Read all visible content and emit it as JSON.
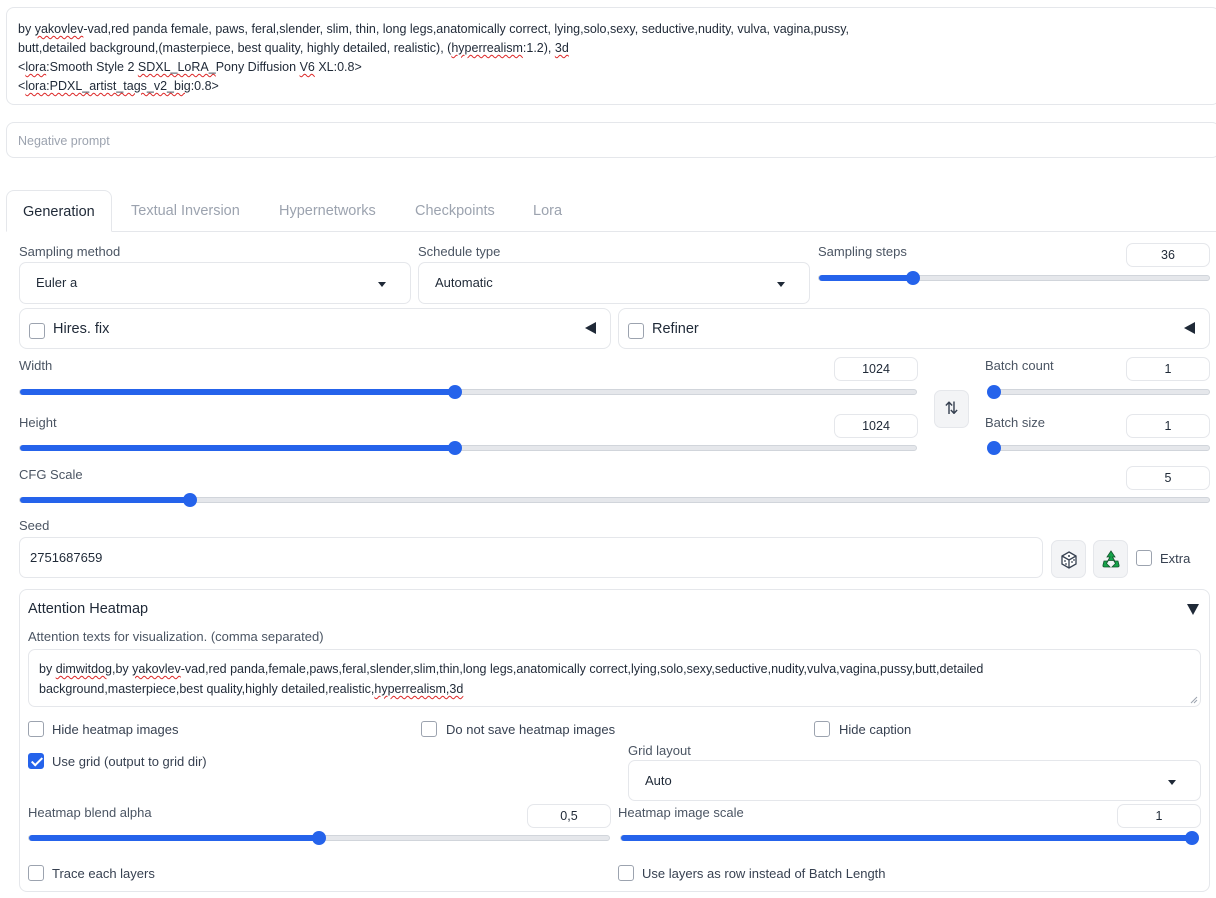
{
  "prompt": {
    "l1a": "by ",
    "l1b": "yakovlev",
    "l1c": "-vad,red panda female, paws, feral,slender, slim, thin, long legs,anatomically correct, lying,solo,sexy, seductive,nudity, vulva, vagina,pussy,",
    "l2a": "butt,detailed background,(masterpiece, best quality, highly detailed, realistic), (",
    "l2b": "hyperrealism",
    "l2c": ":1.2), ",
    "l2d": "3d",
    "l3a": "<",
    "l3b": "lora",
    "l3c": ":Smooth Style 2 ",
    "l3d": "SDXL_LoRA_",
    "l3e": "Pony Diffusion ",
    "l3f": "V6",
    "l3g": " XL:0.8>",
    "l4a": "<",
    "l4b": "lora:PDXL_artist_tags_v2_big",
    "l4c": ":0.8>"
  },
  "negative_prompt": {
    "placeholder": "Negative prompt"
  },
  "tabs": [
    "Generation",
    "Textual Inversion",
    "Hypernetworks",
    "Checkpoints",
    "Lora"
  ],
  "sampling_method": {
    "label": "Sampling method",
    "value": "Euler a"
  },
  "schedule_type": {
    "label": "Schedule type",
    "value": "Automatic"
  },
  "sampling_steps": {
    "label": "Sampling steps",
    "value": "36",
    "fraction": 0.24
  },
  "hires_fix": {
    "label": "Hires. fix"
  },
  "refiner": {
    "label": "Refiner"
  },
  "width": {
    "label": "Width",
    "value": "1024",
    "fraction": 0.485
  },
  "height": {
    "label": "Height",
    "value": "1024",
    "fraction": 0.485
  },
  "batch_count": {
    "label": "Batch count",
    "value": "1",
    "fraction": 0
  },
  "batch_size": {
    "label": "Batch size",
    "value": "1",
    "fraction": 0
  },
  "swap_icon": "⇅",
  "cfg_scale": {
    "label": "CFG Scale",
    "value": "5",
    "fraction": 0.143
  },
  "seed": {
    "label": "Seed",
    "value": "2751687659",
    "extra_label": "Extra"
  },
  "attention_heatmap": {
    "title": "Attention Heatmap",
    "texts_label": "Attention texts for visualization. (comma separated)",
    "t1a": "by ",
    "t1b": "dimwitdog",
    "t1c": ",by ",
    "t1d": "yakovlev",
    "t1e": "-vad,red panda,female,paws,feral,slender,slim,thin,long legs,anatomically correct,lying,solo,sexy,seductive,nudity,vulva,vagina,pussy,butt,detailed",
    "t2a": "background,masterpiece,best quality,highly detailed,realistic,",
    "t2b": "hyperrealism,3d",
    "hide_heatmap_images": "Hide heatmap images",
    "do_not_save": "Do not save heatmap images",
    "hide_caption": "Hide caption",
    "use_grid": "Use grid (output to grid dir)",
    "use_grid_checked": true,
    "grid_layout": {
      "label": "Grid layout",
      "value": "Auto"
    },
    "blend_alpha": {
      "label": "Heatmap blend alpha",
      "value": "0,5",
      "fraction": 0.5
    },
    "image_scale": {
      "label": "Heatmap image scale",
      "value": "1",
      "fraction": 1.0
    },
    "trace_each_layers": "Trace each layers",
    "use_layers_as_row": "Use layers as row instead of Batch Length"
  },
  "colors": {
    "accent": "#2563eb",
    "recycle": "#16a34a"
  }
}
